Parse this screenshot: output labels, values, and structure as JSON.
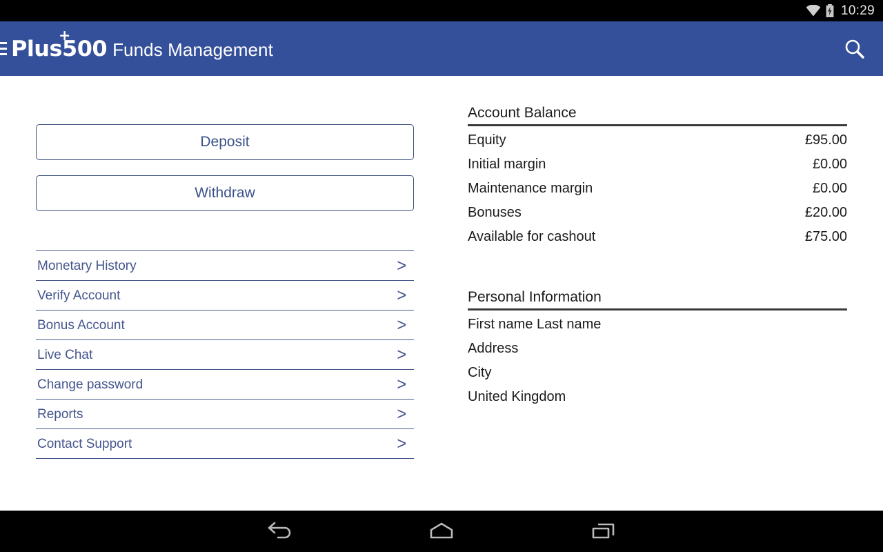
{
  "status_bar": {
    "time": "10:29",
    "wifi_icon": "wifi-icon",
    "battery_icon": "battery-charging-icon"
  },
  "header": {
    "menu_icon": "hamburger-menu-icon",
    "logo_text": "Plus500",
    "logo_plus": "+",
    "title": "Funds Management",
    "search_icon": "search-icon",
    "background_color": "#35509A"
  },
  "actions": {
    "deposit_label": "Deposit",
    "withdraw_label": "Withdraw",
    "accent_color": "#3b5189"
  },
  "menu": {
    "items": [
      {
        "label": "Monetary History",
        "chevron": ">"
      },
      {
        "label": "Verify Account",
        "chevron": ">"
      },
      {
        "label": "Bonus Account",
        "chevron": ">"
      },
      {
        "label": "Live Chat",
        "chevron": ">"
      },
      {
        "label": "Change password",
        "chevron": ">"
      },
      {
        "label": "Reports",
        "chevron": ">"
      },
      {
        "label": "Contact Support",
        "chevron": ">"
      }
    ]
  },
  "account_balance": {
    "title": "Account Balance",
    "rows": [
      {
        "label": "Equity",
        "value": "£95.00"
      },
      {
        "label": "Initial margin",
        "value": "£0.00"
      },
      {
        "label": "Maintenance margin",
        "value": "£0.00"
      },
      {
        "label": "Bonuses",
        "value": "£20.00"
      },
      {
        "label": "Available for cashout",
        "value": "£75.00"
      }
    ]
  },
  "personal_information": {
    "title": "Personal Information",
    "lines": [
      "First name Last name",
      "Address",
      "City",
      "United Kingdom"
    ]
  },
  "nav_bar": {
    "back_icon": "back-arrow-icon",
    "home_icon": "home-icon",
    "recents_icon": "recent-apps-icon"
  }
}
